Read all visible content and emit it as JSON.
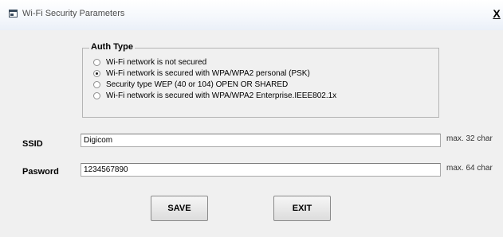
{
  "window": {
    "title": "Wi-Fi Security Parameters",
    "close_label": "X"
  },
  "auth_type": {
    "legend": "Auth Type",
    "options": [
      {
        "label": "Wi-Fi network is not secured",
        "selected": false
      },
      {
        "label": "Wi-Fi network is secured with WPA/WPA2 personal (PSK)",
        "selected": true
      },
      {
        "label": "Security type WEP (40 or 104) OPEN OR SHARED",
        "selected": false
      },
      {
        "label": "Wi-Fi network is secured with WPA/WPA2 Enterprise.IEEE802.1x",
        "selected": false
      }
    ]
  },
  "ssid": {
    "label": "SSID",
    "value": "Digicom",
    "hint": "max. 32 char"
  },
  "password": {
    "label": "Pasword",
    "value": "1234567890",
    "hint": "max. 64 char"
  },
  "buttons": {
    "save": "SAVE",
    "exit": "EXIT"
  },
  "colors": {
    "window_bg": "#f0f0f0",
    "titlebar_bg": "#eef3fa",
    "text": "#000000",
    "border": "#b5b5b5"
  },
  "icons": {
    "app": "window-app-icon",
    "close": "close-icon"
  }
}
